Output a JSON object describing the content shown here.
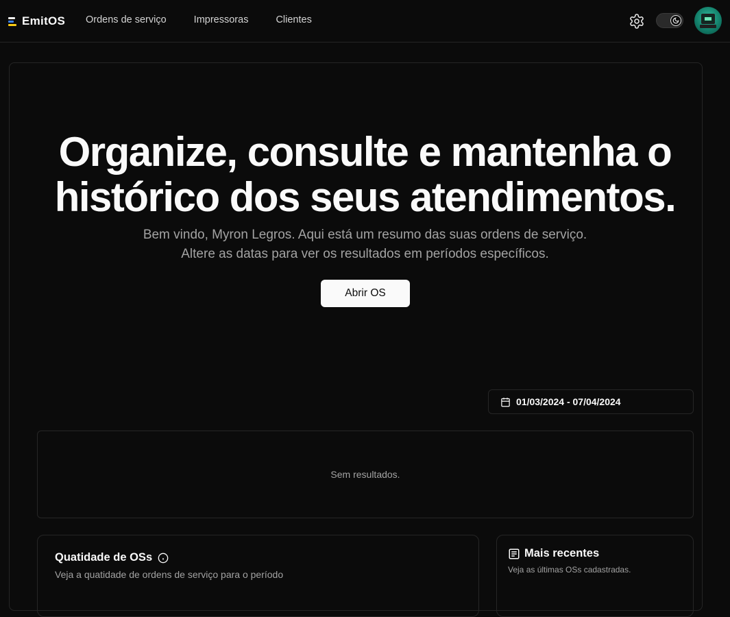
{
  "app": {
    "brand": "EmitOS",
    "nav": [
      "Ordens de serviço",
      "Impressoras",
      "Clientes"
    ]
  },
  "header_icons": [
    "gear-icon",
    "theme-toggle",
    "avatar"
  ],
  "hero": {
    "headline_line1": "Organize, consulte e mantenha o",
    "headline_line2": "histórico dos seus atendimentos.",
    "subtitle_line1": "Bem vindo, Myron Legros. Aqui está um resumo das suas ordens de serviço.",
    "subtitle_line2": "Altere as datas para ver os resultados em períodos específicos.",
    "cta_label": "Abrir OS"
  },
  "date_range": {
    "icon": "calendar-icon",
    "value": "01/03/2024 - 07/04/2024"
  },
  "results": {
    "empty_text": "Sem resultados."
  },
  "quantity_card": {
    "title": "Quatidade de OSs",
    "icon": "info-icon",
    "description": "Veja a quatidade de ordens de serviço para o período"
  },
  "recent_card": {
    "title": "Mais recentes",
    "icon": "list-icon",
    "description": "Veja as últimas OSs cadastradas."
  },
  "colors": {
    "background": "#0b0b0b",
    "border": "#262626",
    "text": "#fafafa",
    "muted": "#a3a3a3",
    "brand_blue": "#3b82f6",
    "brand_yellow": "#facc15",
    "avatar_green": "#117a66"
  }
}
